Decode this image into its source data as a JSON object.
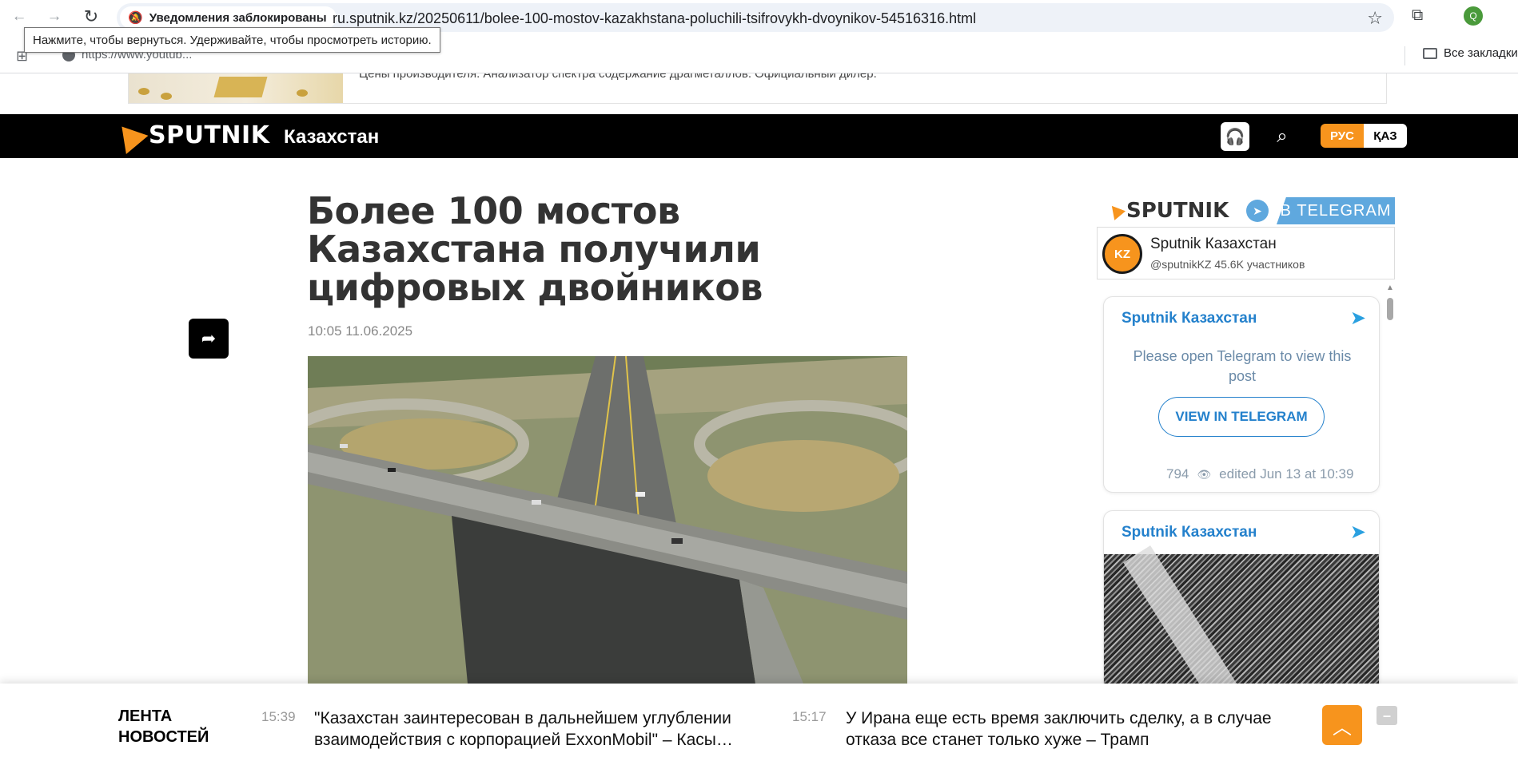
{
  "browser": {
    "notification_chip": "Уведомления заблокированы",
    "url": "ru.sputnik.kz/20250611/bolee-100-mostov-kazakhstana-poluchili-tsifrovykh-dvoynikov-54516316.html",
    "back_tooltip": "Нажмите, чтобы вернуться. Удерживайте, чтобы просмотреть историю.",
    "bookmark_item": "https://www.youtub...",
    "all_bookmarks": "Все закладки",
    "profile_initial": "Q"
  },
  "ad": {
    "text": "Цены производителя. Анализатор спектра содержание драгметаллов. Официальный дилер."
  },
  "header": {
    "logo": "SPUTNIK",
    "region": "Казахстан",
    "lang_active": "РУС",
    "lang_other": "ҚАЗ",
    "brand_color": "#f7941d"
  },
  "article": {
    "title": "Более 100 мостов Казахстана получили цифровых двойников",
    "date": "10:05 11.06.2025",
    "photo_icon": "highway-interchange-photo"
  },
  "sidebar": {
    "telegram_banner": {
      "logo": "SPUTNIK",
      "label": "В TELEGRAM"
    },
    "channel": {
      "avatar": "KZ",
      "name": "Sputnik Казахстан",
      "subtitle": "@sputnikKZ 45.6K участников"
    },
    "posts": [
      {
        "title": "Sputnik Казахстан",
        "message": "Please open Telegram to view this post",
        "button": "VIEW IN TELEGRAM",
        "views": "794",
        "edited": "edited  Jun 13 at 10:39"
      },
      {
        "title": "Sputnik Казахстан"
      }
    ]
  },
  "ticker": {
    "label": "ЛЕНТА НОВОСТЕЙ",
    "items": [
      {
        "time": "15:39",
        "text": "\"Казахстан заинтересован в дальнейшем углублении взаимодействия с корпорацией ExxonMobil\" – Касы…"
      },
      {
        "time": "15:17",
        "text": "У Ирана еще есть время заключить сделку, а в случае отказа все станет только хуже – Трамп"
      }
    ]
  }
}
